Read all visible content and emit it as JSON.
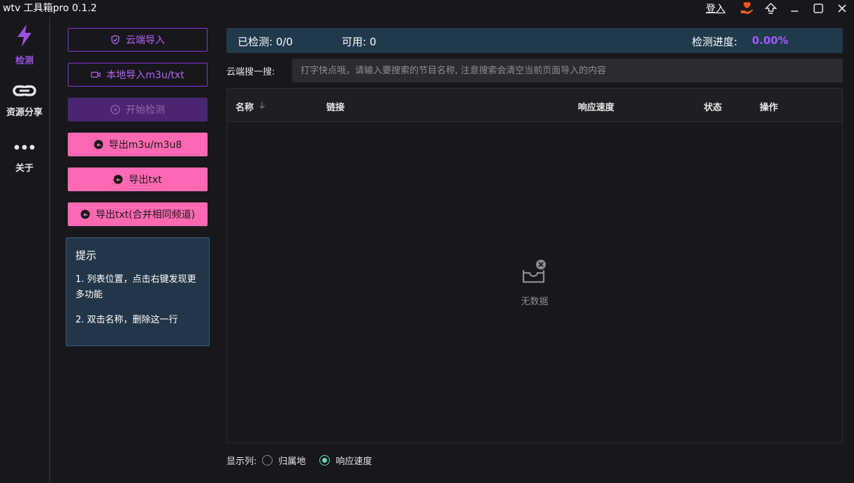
{
  "window": {
    "title": "wtv 工具箱pro 0.1.2",
    "login": "登入"
  },
  "sidebar": {
    "items": [
      {
        "label": "检测",
        "icon": "bolt-icon",
        "active": true
      },
      {
        "label": "资源分享",
        "icon": "link-icon",
        "active": false
      },
      {
        "label": "关于",
        "icon": "more-dots-icon",
        "active": false
      }
    ]
  },
  "actions": {
    "cloud_import": "云端导入",
    "local_import": "本地导入m3u/txt",
    "start_check": "开始检测",
    "export_m3u": "导出m3u/m3u8",
    "export_txt": "导出txt",
    "export_txt_merge": "导出txt(合并相同频道)"
  },
  "tips": {
    "title": "提示",
    "line1": "1. 列表位置，点击右键发现更多功能",
    "line2": "2. 双击名称，删除这一行"
  },
  "status": {
    "checked": "已检测: 0/0",
    "available": "可用: 0",
    "progress_label": "检测进度:",
    "progress_value": "0.00%"
  },
  "search": {
    "label": "云端搜一搜:",
    "placeholder": "打字快点哦，请输入要搜索的节目名称, 注意搜索会清空当前页面导入的内容"
  },
  "table": {
    "columns": [
      "名称",
      "链接",
      "响应速度",
      "状态",
      "操作"
    ],
    "empty_text": "无数据"
  },
  "columns_bar": {
    "label": "显示列:",
    "options": [
      {
        "label": "归属地",
        "checked": false
      },
      {
        "label": "响应速度",
        "checked": true
      }
    ]
  },
  "colors": {
    "accent": "#9b51e0",
    "pink": "#ff69b4",
    "status_bg": "#203a4c",
    "radio_on": "#5fdca8"
  }
}
